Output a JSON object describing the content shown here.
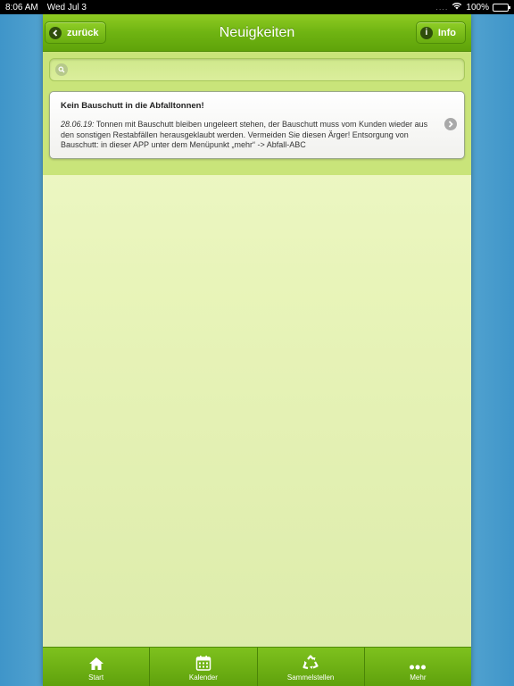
{
  "status_bar": {
    "time": "8:06 AM",
    "date": "Wed Jul 3",
    "battery": "100%",
    "battery_level": 1.0
  },
  "header": {
    "title": "Neuigkeiten",
    "back_label": "zurück",
    "info_label": "Info"
  },
  "search": {
    "value": "",
    "placeholder": ""
  },
  "news": [
    {
      "title": "Kein Bauschutt in die Abfalltonnen!",
      "date": "28.06.19:",
      "body": " Tonnen mit Bauschutt bleiben ungeleert stehen, der Bauschutt muss vom Kunden wieder aus den sonstigen Restabfällen herausgeklaubt werden. Vermeiden Sie diesen Ärger! Entsorgung von Bauschutt: in dieser APP unter dem Menüpunkt „mehr“ -> Abfall-ABC"
    }
  ],
  "tabbar": {
    "tabs": [
      {
        "label": "Start",
        "icon": "home-icon"
      },
      {
        "label": "Kalender",
        "icon": "calendar-icon"
      },
      {
        "label": "Sammelstellen",
        "icon": "recycle-icon"
      },
      {
        "label": "Mehr",
        "icon": "more-icon"
      }
    ]
  },
  "colors": {
    "brand_green": "#6fb412",
    "content_bg": "#e8f4b9",
    "background_blue": "#3f95c9"
  }
}
